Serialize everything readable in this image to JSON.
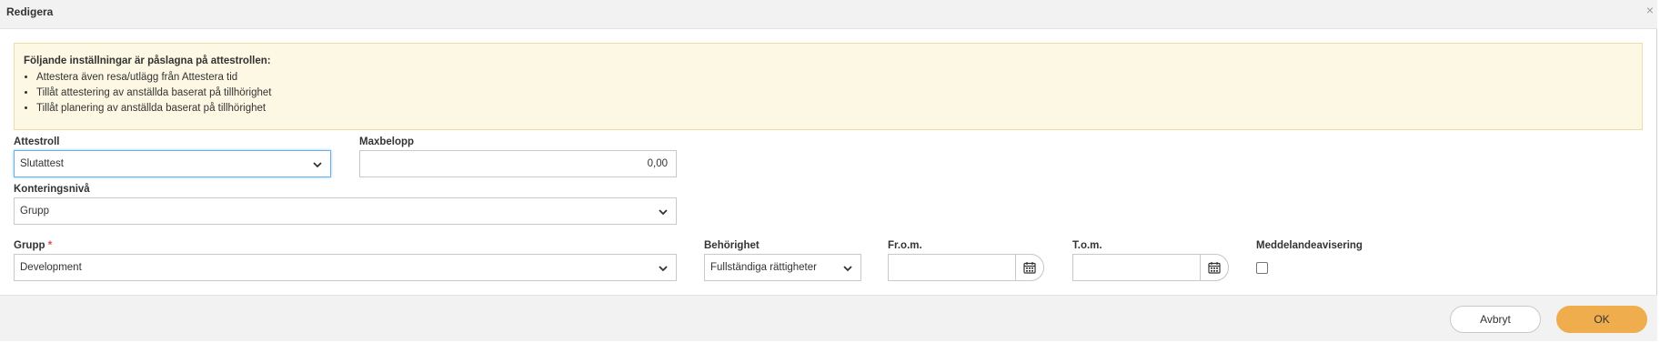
{
  "dialog": {
    "title": "Redigera",
    "close_glyph": "×"
  },
  "info": {
    "heading": "Följande inställningar är påslagna på attestrollen:",
    "items": [
      "Attestera även resa/utlägg från Attestera tid",
      "Tillåt attestering av anställda baserat på tillhörighet",
      "Tillåt planering av anställda baserat på tillhörighet"
    ]
  },
  "form": {
    "attestroll": {
      "label": "Attestroll",
      "value": "Slutattest"
    },
    "maxbelopp": {
      "label": "Maxbelopp",
      "value": "0,00"
    },
    "konteringsniva": {
      "label": "Konteringsnivå",
      "value": "Grupp"
    },
    "grupp": {
      "label": "Grupp",
      "required_mark": "*",
      "value": "Development"
    },
    "behorighet": {
      "label": "Behörighet",
      "value": "Fullständiga rättigheter"
    },
    "from": {
      "label": "Fr.o.m.",
      "value": ""
    },
    "tom": {
      "label": "T.o.m.",
      "value": ""
    },
    "meddelande": {
      "label": "Meddelandeavisering",
      "checked": false
    }
  },
  "footer": {
    "cancel_label": "Avbryt",
    "ok_label": "OK"
  },
  "colors": {
    "primary": "#f0ad4e",
    "info_bg": "#fcf8e3",
    "required": "#d9534f",
    "focus": "#66afe9"
  }
}
